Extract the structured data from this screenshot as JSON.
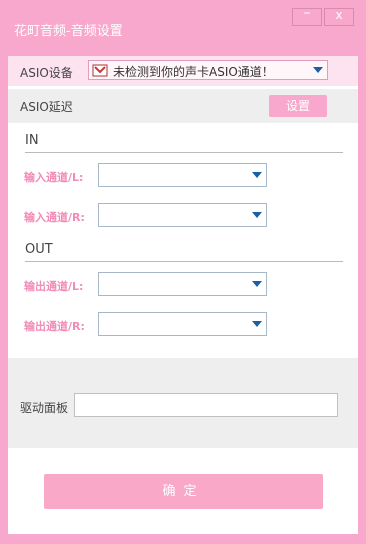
{
  "window": {
    "title": "花町音频-音频设置",
    "minimize_glyph": "–",
    "close_glyph": "x"
  },
  "asio": {
    "label": "ASIO设备",
    "selected": "未检测到你的声卡ASIO通道！",
    "icon": "asio-device-icon"
  },
  "latency": {
    "label": "ASIO延迟",
    "settings_button": "设置"
  },
  "in_section": {
    "title": "IN",
    "channels": [
      {
        "label": "输入通道/L:",
        "value": ""
      },
      {
        "label": "输入通道/R:",
        "value": ""
      }
    ]
  },
  "out_section": {
    "title": "OUT",
    "channels": [
      {
        "label": "输出通道/L:",
        "value": ""
      },
      {
        "label": "输出通道/R:",
        "value": ""
      }
    ]
  },
  "driver": {
    "label": "驱动面板",
    "value": ""
  },
  "confirm_button": "确定",
  "colors": {
    "accent": "#f7a8cc",
    "label_pink": "#f08cb6",
    "dropdown_arrow": "#1a5fa8"
  }
}
